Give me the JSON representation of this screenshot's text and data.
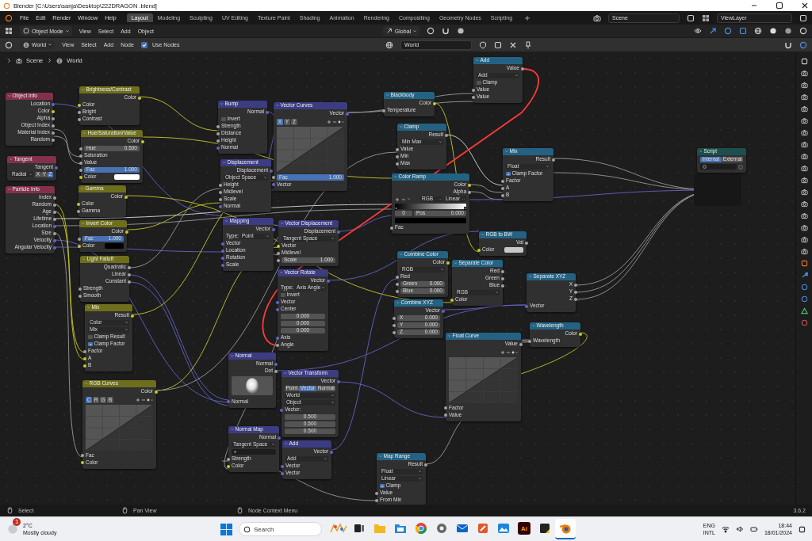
{
  "window": {
    "title": "Blender [C:\\Users\\sanja\\Desktop\\222DRAGON .blend]"
  },
  "menu": [
    "File",
    "Edit",
    "Render",
    "Window",
    "Help"
  ],
  "workspaces": [
    {
      "label": "Layout",
      "selected": true
    },
    {
      "label": "Modeling",
      "selected": false
    },
    {
      "label": "Sculpting",
      "selected": false
    },
    {
      "label": "UV Editing",
      "selected": false
    },
    {
      "label": "Texture Paint",
      "selected": false
    },
    {
      "label": "Shading",
      "selected": false
    },
    {
      "label": "Animation",
      "selected": false
    },
    {
      "label": "Rendering",
      "selected": false
    },
    {
      "label": "Compositing",
      "selected": false
    },
    {
      "label": "Geometry Nodes",
      "selected": false
    },
    {
      "label": "Scripting",
      "selected": false
    }
  ],
  "scene": "Scene",
  "view_layer": "ViewLayer",
  "viewport_header": {
    "mode": "Object Mode",
    "menus": [
      "View",
      "Select",
      "Add",
      "Object"
    ],
    "orientation": "Global"
  },
  "node_header": {
    "shader_type": "World",
    "menus": [
      "View",
      "Select",
      "Add",
      "Node"
    ],
    "use_nodes": {
      "label": "Use Nodes",
      "checked": true
    },
    "world": "World"
  },
  "breadcrumbs": [
    "Scene",
    "World"
  ],
  "nodes": [
    {
      "title": "Object Info",
      "color": "#83314a",
      "rows": [
        {
          "kind": "output",
          "label": "Location",
          "socket": {
            "color": "#6363c7"
          }
        },
        {
          "kind": "output",
          "label": "Color",
          "socket": {
            "color": "#c7c729"
          }
        },
        {
          "kind": "output",
          "label": "Alpha",
          "socket": {
            "color": "#a1a1a1"
          }
        },
        {
          "kind": "output",
          "label": "Object Index",
          "socket": {
            "color": "#a1a1a1"
          }
        },
        {
          "kind": "output",
          "label": "Material Index",
          "socket": {
            "color": "#a1a1a1"
          }
        },
        {
          "kind": "output",
          "label": "Random",
          "socket": {
            "color": "#a1a1a1"
          }
        }
      ]
    },
    {
      "title": "Tangent",
      "color": "#83314a",
      "rows": [
        {
          "kind": "output",
          "label": "Tangent",
          "socket": {
            "color": "#6363c7"
          }
        },
        {
          "kind": "dropdown-toggles",
          "value": "Radial",
          "axes": [
            {
              "label": "X",
              "selected": false
            },
            {
              "label": "Y",
              "selected": false
            },
            {
              "label": "Z",
              "selected": true
            }
          ]
        }
      ]
    },
    {
      "title": "Particle Info",
      "color": "#83314a",
      "rows": [
        {
          "kind": "output",
          "label": "Index",
          "socket": {
            "color": "#a1a1a1"
          }
        },
        {
          "kind": "output",
          "label": "Random",
          "socket": {
            "color": "#a1a1a1"
          }
        },
        {
          "kind": "output",
          "label": "Age",
          "socket": {
            "color": "#a1a1a1"
          }
        },
        {
          "kind": "output",
          "label": "Lifetime",
          "socket": {
            "color": "#a1a1a1"
          }
        },
        {
          "kind": "output",
          "label": "Location",
          "socket": {
            "color": "#6363c7"
          }
        },
        {
          "kind": "output",
          "label": "Size",
          "socket": {
            "color": "#a1a1a1"
          }
        },
        {
          "kind": "output",
          "label": "Velocity",
          "socket": {
            "color": "#6363c7"
          }
        },
        {
          "kind": "output",
          "label": "Angular Velocity",
          "socket": {
            "color": "#6363c7"
          }
        }
      ]
    },
    {
      "title": "Brightness/Contrast",
      "color": "#6e6e1d",
      "rows": [
        {
          "kind": "output",
          "label": "Color",
          "socket": {
            "color": "#c7c729"
          }
        },
        {
          "kind": "input",
          "label": "Color",
          "socket": {
            "color": "#c7c729"
          }
        },
        {
          "kind": "input",
          "label": "Bright",
          "socket": {
            "color": "#a1a1a1"
          }
        },
        {
          "kind": "input",
          "label": "Contrast",
          "socket": {
            "color": "#a1a1a1"
          }
        }
      ]
    },
    {
      "title": "Hue/Saturation/Value",
      "color": "#6e6e1d",
      "rows": [
        {
          "kind": "output",
          "label": "Color",
          "socket": {
            "color": "#c7c729"
          }
        },
        {
          "kind": "field",
          "label": "Hue",
          "value": "0.500",
          "socket": {
            "color": "#a1a1a1"
          }
        },
        {
          "kind": "input",
          "label": "Saturation",
          "socket": {
            "color": "#a1a1a1"
          }
        },
        {
          "kind": "input",
          "label": "Value",
          "socket": {
            "color": "#a1a1a1"
          }
        },
        {
          "kind": "slider",
          "label": "Fac",
          "value": "1.000",
          "level": 1,
          "socket": {
            "color": "#a1a1a1"
          }
        },
        {
          "kind": "swatch",
          "label": "Color",
          "socket": {
            "color": "#c7c729"
          },
          "color": "#ffffff"
        }
      ]
    },
    {
      "title": "Gamma",
      "color": "#6e6e1d",
      "rows": [
        {
          "kind": "output",
          "label": "Color",
          "socket": {
            "color": "#c7c729"
          }
        },
        {
          "kind": "input",
          "label": "Color",
          "socket": {
            "color": "#c7c729"
          }
        },
        {
          "kind": "input",
          "label": "Gamma",
          "socket": {
            "color": "#a1a1a1"
          }
        }
      ]
    },
    {
      "title": "Invert Color",
      "color": "#6e6e1d",
      "rows": [
        {
          "kind": "output",
          "label": "Color",
          "socket": {
            "color": "#c7c729"
          }
        },
        {
          "kind": "slider",
          "label": "Fac",
          "value": "1.000",
          "level": 1,
          "socket": {
            "color": "#a1a1a1"
          }
        },
        {
          "kind": "swatch",
          "label": "Color",
          "socket": {
            "color": "#c7c729"
          },
          "color": "#000000"
        }
      ]
    },
    {
      "title": "Light Falloff",
      "color": "#6e6e1d",
      "rows": [
        {
          "kind": "output",
          "label": "Quadratic",
          "socket": {
            "color": "#a1a1a1"
          }
        },
        {
          "kind": "output",
          "label": "Linear",
          "socket": {
            "color": "#a1a1a1"
          }
        },
        {
          "kind": "output",
          "label": "Constant",
          "socket": {
            "color": "#a1a1a1"
          }
        },
        {
          "kind": "input",
          "label": "Strength",
          "socket": {
            "color": "#a1a1a1"
          }
        },
        {
          "kind": "input",
          "label": "Smooth",
          "socket": {
            "color": "#a1a1a1"
          }
        }
      ]
    },
    {
      "title": "Mix",
      "color": "#6e6e1d",
      "rows": [
        {
          "kind": "output",
          "label": "Result",
          "socket": {
            "color": "#c7c729"
          }
        },
        {
          "kind": "dropdown",
          "value": "Color"
        },
        {
          "kind": "dropdown",
          "value": "Mix"
        },
        {
          "kind": "checkbox",
          "label": "Clamp Result",
          "checked": false
        },
        {
          "kind": "checkbox",
          "label": "Clamp Factor",
          "checked": true
        },
        {
          "kind": "input",
          "label": "Factor",
          "socket": {
            "color": "#a1a1a1"
          }
        },
        {
          "kind": "input",
          "label": "A",
          "socket": {
            "color": "#c7c729"
          }
        },
        {
          "kind": "input",
          "label": "B",
          "socket": {
            "color": "#c7c729"
          }
        }
      ]
    },
    {
      "title": "RGB Curves",
      "color": "#6e6e1d",
      "rows": [
        {
          "kind": "output",
          "label": "Color",
          "socket": {
            "color": "#c7c729"
          }
        },
        {
          "kind": "curve",
          "channels": [
            {
              "label": "C",
              "selected": true
            },
            {
              "label": "R",
              "selected": false
            },
            {
              "label": "G",
              "selected": false
            },
            {
              "label": "B",
              "selected": false
            }
          ]
        },
        {
          "kind": "input",
          "label": "Fac",
          "socket": {
            "color": "#a1a1a1"
          }
        },
        {
          "kind": "input",
          "label": "Color",
          "socket": {
            "color": "#c7c729"
          }
        }
      ]
    },
    {
      "title": "Bump",
      "color": "#3c3c83",
      "rows": [
        {
          "kind": "output",
          "label": "Normal",
          "socket": {
            "color": "#6363c7"
          }
        },
        {
          "kind": "checkbox",
          "label": "Invert",
          "checked": false
        },
        {
          "kind": "input",
          "label": "Strength",
          "socket": {
            "color": "#a1a1a1"
          }
        },
        {
          "kind": "input",
          "label": "Distance",
          "socket": {
            "color": "#a1a1a1"
          }
        },
        {
          "kind": "input",
          "label": "Height",
          "socket": {
            "color": "#a1a1a1"
          }
        },
        {
          "kind": "input",
          "label": "Normal",
          "socket": {
            "color": "#6363c7"
          }
        }
      ]
    },
    {
      "title": "Displacement",
      "color": "#3c3c83",
      "rows": [
        {
          "kind": "output",
          "label": "Displacement",
          "socket": {
            "color": "#6363c7"
          }
        },
        {
          "kind": "dropdown",
          "value": "Object Space"
        },
        {
          "kind": "input",
          "label": "Height",
          "socket": {
            "color": "#a1a1a1"
          }
        },
        {
          "kind": "input",
          "label": "Midlevel",
          "socket": {
            "color": "#a1a1a1"
          }
        },
        {
          "kind": "input",
          "label": "Scale",
          "socket": {
            "color": "#a1a1a1"
          }
        },
        {
          "kind": "input",
          "label": "Normal",
          "socket": {
            "color": "#6363c7"
          }
        }
      ]
    },
    {
      "title": "Mapping",
      "color": "#3c3c83",
      "rows": [
        {
          "kind": "output",
          "label": "Vector",
          "socket": {
            "color": "#6363c7"
          }
        },
        {
          "kind": "labeled-dropdown",
          "label": "Type:",
          "value": "Point"
        },
        {
          "kind": "input",
          "label": "Vector",
          "socket": {
            "color": "#6363c7"
          }
        },
        {
          "kind": "input",
          "label": "Location",
          "socket": {
            "color": "#6363c7"
          }
        },
        {
          "kind": "input",
          "label": "Rotation",
          "socket": {
            "color": "#6363c7"
          }
        },
        {
          "kind": "input",
          "label": "Scale",
          "socket": {
            "color": "#6363c7"
          }
        }
      ]
    },
    {
      "title": "Normal",
      "color": "#3c3c83",
      "rows": [
        {
          "kind": "output",
          "label": "Normal",
          "socket": {
            "color": "#6363c7"
          }
        },
        {
          "kind": "output",
          "label": "Dot",
          "socket": {
            "color": "#a1a1a1"
          }
        },
        {
          "kind": "sphere"
        },
        {
          "kind": "input",
          "label": "Normal",
          "socket": {
            "color": "#6363c7"
          }
        }
      ]
    },
    {
      "title": "Normal Map",
      "color": "#3c3c83",
      "rows": [
        {
          "kind": "output",
          "label": "Normal",
          "socket": {
            "color": "#6363c7"
          }
        },
        {
          "kind": "dropdown",
          "value": "Tangent Space"
        },
        {
          "kind": "text-field"
        },
        {
          "kind": "input",
          "label": "Strength",
          "socket": {
            "color": "#a1a1a1"
          }
        },
        {
          "kind": "input",
          "label": "Color",
          "socket": {
            "color": "#c7c729"
          }
        }
      ]
    },
    {
      "title": "Vector Curves",
      "color": "#3c3c83",
      "rows": [
        {
          "kind": "output",
          "label": "Vector",
          "socket": {
            "color": "#6363c7"
          }
        },
        {
          "kind": "curve",
          "channels": [
            {
              "label": "X",
              "selected": true
            },
            {
              "label": "Y",
              "selected": false
            },
            {
              "label": "Z",
              "selected": false
            }
          ]
        },
        {
          "kind": "slider",
          "label": "Fac",
          "value": "1.000",
          "level": 1,
          "socket": {
            "color": "#a1a1a1"
          }
        },
        {
          "kind": "input",
          "label": "Vector",
          "socket": {
            "color": "#6363c7"
          }
        }
      ]
    },
    {
      "title": "Vector Displacement",
      "color": "#3c3c83",
      "rows": [
        {
          "kind": "output",
          "label": "Displacement",
          "socket": {
            "color": "#6363c7"
          }
        },
        {
          "kind": "dropdown",
          "value": "Tangent Space"
        },
        {
          "kind": "input",
          "label": "Vector",
          "socket": {
            "color": "#c7c729"
          }
        },
        {
          "kind": "input",
          "label": "Midlevel",
          "socket": {
            "color": "#a1a1a1"
          }
        },
        {
          "kind": "field",
          "label": "Scale",
          "value": "1.000",
          "socket": {
            "color": "#a1a1a1"
          }
        }
      ]
    },
    {
      "title": "Vector Rotate",
      "color": "#3c3c83",
      "rows": [
        {
          "kind": "output",
          "label": "Vector",
          "socket": {
            "color": "#6363c7"
          }
        },
        {
          "kind": "labeled-dropdown",
          "label": "Type:",
          "value": "Axis Angle"
        },
        {
          "kind": "checkbox",
          "label": "Invert",
          "checked": false
        },
        {
          "kind": "input",
          "label": "Vector",
          "socket": {
            "color": "#6363c7"
          }
        },
        {
          "kind": "input",
          "label": "Center",
          "socket": {
            "color": "#6363c7"
          }
        },
        {
          "kind": "value",
          "value": "0.000"
        },
        {
          "kind": "value",
          "value": "0.000"
        },
        {
          "kind": "value",
          "value": "0.000"
        },
        {
          "kind": "input",
          "label": "Axis",
          "socket": {
            "color": "#6363c7"
          }
        },
        {
          "kind": "input",
          "label": "Angle",
          "socket": {
            "color": "#a1a1a1"
          }
        }
      ]
    },
    {
      "title": "Vector Transform",
      "color": "#3c3c83",
      "rows": [
        {
          "kind": "output",
          "label": "Vector",
          "socket": {
            "color": "#6363c7"
          }
        },
        {
          "kind": "toggles",
          "options": [
            {
              "label": "Point",
              "selected": false
            },
            {
              "label": "Vector",
              "selected": true
            },
            {
              "label": "Normal",
              "selected": false
            }
          ]
        },
        {
          "kind": "dropdown",
          "value": "World"
        },
        {
          "kind": "dropdown",
          "value": "Object"
        },
        {
          "kind": "input",
          "label": "Vector:",
          "socket": {
            "color": "#6363c7"
          }
        },
        {
          "kind": "value",
          "value": "0.500"
        },
        {
          "kind": "value",
          "value": "0.500"
        },
        {
          "kind": "value",
          "value": "0.500"
        }
      ]
    },
    {
      "title": "Add",
      "color": "#3c3c83",
      "rows": [
        {
          "kind": "output",
          "label": "Vector",
          "socket": {
            "color": "#6363c7"
          }
        },
        {
          "kind": "dropdown",
          "value": "Add"
        },
        {
          "kind": "input",
          "label": "Vector",
          "socket": {
            "color": "#6363c7"
          }
        },
        {
          "kind": "input",
          "label": "Vector",
          "socket": {
            "color": "#6363c7"
          }
        }
      ]
    },
    {
      "title": "Blackbody",
      "color": "#246283",
      "rows": [
        {
          "kind": "output",
          "label": "Color",
          "socket": {
            "color": "#c7c729"
          }
        },
        {
          "kind": "input",
          "label": "Temperature",
          "socket": {
            "color": "#a1a1a1"
          }
        }
      ]
    },
    {
      "title": "Clamp",
      "color": "#246283",
      "rows": [
        {
          "kind": "output",
          "label": "Result",
          "socket": {
            "color": "#a1a1a1"
          }
        },
        {
          "kind": "dropdown",
          "value": "Min Max"
        },
        {
          "kind": "input",
          "label": "Value",
          "socket": {
            "color": "#a1a1a1"
          }
        },
        {
          "kind": "input",
          "label": "Min",
          "socket": {
            "color": "#a1a1a1"
          }
        },
        {
          "kind": "input",
          "label": "Max",
          "socket": {
            "color": "#a1a1a1"
          }
        }
      ]
    },
    {
      "title": "Color Ramp",
      "color": "#246283",
      "rows": [
        {
          "kind": "output",
          "label": "Color",
          "socket": {
            "color": "#c7c729"
          }
        },
        {
          "kind": "output",
          "label": "Alpha",
          "socket": {
            "color": "#a1a1a1"
          }
        },
        {
          "kind": "ramp-controls",
          "mode": "RGB",
          "interpolation": "Linear"
        },
        {
          "kind": "gradient"
        },
        {
          "kind": "ramp-stop",
          "index": "0",
          "label": "Pos",
          "value": "0.000"
        },
        {
          "kind": "color-bar",
          "color": "#000000"
        },
        {
          "kind": "input",
          "label": "Fac",
          "socket": {
            "color": "#a1a1a1"
          }
        }
      ]
    },
    {
      "title": "Combine Color",
      "color": "#246283",
      "rows": [
        {
          "kind": "output",
          "label": "Color",
          "socket": {
            "color": "#c7c729"
          }
        },
        {
          "kind": "dropdown",
          "value": "RGB"
        },
        {
          "kind": "input",
          "label": "Red",
          "socket": {
            "color": "#a1a1a1"
          }
        },
        {
          "kind": "field",
          "label": "Green",
          "value": "0.000",
          "socket": {
            "color": "#a1a1a1"
          }
        },
        {
          "kind": "field",
          "label": "Blue",
          "value": "0.000",
          "socket": {
            "color": "#a1a1a1"
          }
        }
      ]
    },
    {
      "title": "Combine XYZ",
      "color": "#246283",
      "rows": [
        {
          "kind": "output",
          "label": "Vector",
          "socket": {
            "color": "#6363c7"
          }
        },
        {
          "kind": "field",
          "label": "X",
          "value": "0.000",
          "socket": {
            "color": "#a1a1a1"
          }
        },
        {
          "kind": "field",
          "label": "Y",
          "value": "0.000",
          "socket": {
            "color": "#a1a1a1"
          }
        },
        {
          "kind": "field",
          "label": "Z",
          "value": "0.000",
          "socket": {
            "color": "#a1a1a1"
          }
        }
      ]
    },
    {
      "title": "Map Range",
      "color": "#246283",
      "rows": [
        {
          "kind": "output",
          "label": "Result",
          "socket": {
            "color": "#a1a1a1"
          }
        },
        {
          "kind": "dropdown",
          "value": "Float"
        },
        {
          "kind": "dropdown",
          "value": "Linear"
        },
        {
          "kind": "checkbox",
          "label": "Clamp",
          "checked": true
        },
        {
          "kind": "input",
          "label": "Value",
          "socket": {
            "color": "#a1a1a1"
          }
        },
        {
          "kind": "input",
          "label": "From Min",
          "socket": {
            "color": "#a1a1a1"
          }
        }
      ]
    },
    {
      "title": "Add",
      "color": "#246283",
      "rows": [
        {
          "kind": "output",
          "label": "Value",
          "socket": {
            "color": "#a1a1a1"
          }
        },
        {
          "kind": "dropdown",
          "value": "Add"
        },
        {
          "kind": "checkbox",
          "label": "Clamp",
          "checked": false
        },
        {
          "kind": "input",
          "label": "Value",
          "socket": {
            "color": "#a1a1a1"
          }
        },
        {
          "kind": "input",
          "label": "Value",
          "socket": {
            "color": "#a1a1a1"
          }
        }
      ]
    },
    {
      "title": "RGB to BW",
      "color": "#246283",
      "rows": [
        {
          "kind": "output",
          "label": "Val",
          "socket": {
            "color": "#a1a1a1"
          }
        },
        {
          "kind": "swatch",
          "label": "Color",
          "socket": {
            "color": "#c7c729"
          },
          "color": "#c8c8c8"
        }
      ]
    },
    {
      "title": "Separate Color",
      "color": "#246283",
      "rows": [
        {
          "kind": "output",
          "label": "Red",
          "socket": {
            "color": "#a1a1a1"
          }
        },
        {
          "kind": "output",
          "label": "Green",
          "socket": {
            "color": "#a1a1a1"
          }
        },
        {
          "kind": "output",
          "label": "Blue",
          "socket": {
            "color": "#a1a1a1"
          }
        },
        {
          "kind": "dropdown",
          "value": "RGB"
        },
        {
          "kind": "input",
          "label": "Color",
          "socket": {
            "color": "#c7c729"
          }
        }
      ]
    },
    {
      "title": "Float Curve",
      "color": "#246283",
      "rows": [
        {
          "kind": "output",
          "label": "Value",
          "socket": {
            "color": "#a1a1a1"
          }
        },
        {
          "kind": "curve",
          "channels": []
        },
        {
          "kind": "input",
          "label": "Factor",
          "socket": {
            "color": "#a1a1a1"
          }
        },
        {
          "kind": "input",
          "label": "Value",
          "socket": {
            "color": "#a1a1a1"
          }
        }
      ]
    },
    {
      "title": "Mix",
      "color": "#246283",
      "rows": [
        {
          "kind": "output",
          "label": "Result",
          "socket": {
            "color": "#a1a1a1"
          }
        },
        {
          "kind": "dropdown",
          "value": "Float"
        },
        {
          "kind": "checkbox",
          "label": "Clamp Factor",
          "checked": true
        },
        {
          "kind": "input",
          "label": "Factor",
          "socket": {
            "color": "#a1a1a1"
          }
        },
        {
          "kind": "input",
          "label": "A",
          "socket": {
            "color": "#a1a1a1"
          }
        },
        {
          "kind": "input",
          "label": "B",
          "socket": {
            "color": "#a1a1a1"
          }
        }
      ]
    },
    {
      "title": "Separate XYZ",
      "color": "#246283",
      "rows": [
        {
          "kind": "output",
          "label": "X",
          "socket": {
            "color": "#a1a1a1"
          }
        },
        {
          "kind": "output",
          "label": "Y",
          "socket": {
            "color": "#a1a1a1"
          }
        },
        {
          "kind": "output",
          "label": "Z",
          "socket": {
            "color": "#a1a1a1"
          }
        },
        {
          "kind": "input",
          "label": "Vector",
          "socket": {
            "color": "#6363c7"
          }
        }
      ]
    },
    {
      "title": "Wavelength",
      "color": "#246283",
      "rows": [
        {
          "kind": "output",
          "label": "Color",
          "socket": {
            "color": "#c7c729"
          }
        },
        {
          "kind": "input",
          "label": "Wavelength",
          "socket": {
            "color": "#a1a1a1"
          }
        }
      ]
    },
    {
      "title": "Script",
      "color": "#1d4f4f",
      "rows": [
        {
          "kind": "toggles",
          "options": [
            {
              "label": "Internal",
              "selected": true
            },
            {
              "label": "External",
              "selected": false
            }
          ]
        },
        {
          "kind": "file-field"
        }
      ]
    }
  ],
  "status_bar": {
    "hints": [
      "Select",
      "Pan View",
      "Node Context Menu"
    ],
    "version": "3.6.2"
  },
  "taskbar": {
    "weather": {
      "badge": "1",
      "temperature": "2°C",
      "condition": "Mostly cloudy"
    },
    "search": {
      "placeholder": "Search"
    },
    "apps": [
      {
        "kind": "widgets",
        "active": false
      },
      {
        "kind": "task-view",
        "active": false
      },
      {
        "kind": "files",
        "active": false
      },
      {
        "kind": "folder",
        "active": false
      },
      {
        "kind": "browser",
        "active": false
      },
      {
        "kind": "settings",
        "active": false
      },
      {
        "kind": "mail",
        "active": false
      },
      {
        "kind": "paint",
        "active": false
      },
      {
        "kind": "photos",
        "active": false
      },
      {
        "kind": "illustrator",
        "label": "Ai",
        "active": false
      },
      {
        "kind": "notes",
        "active": false
      },
      {
        "kind": "blender",
        "active": true
      }
    ],
    "language": [
      "ENG",
      "INTL"
    ],
    "time": "18:44",
    "date": "18/01/2024"
  }
}
